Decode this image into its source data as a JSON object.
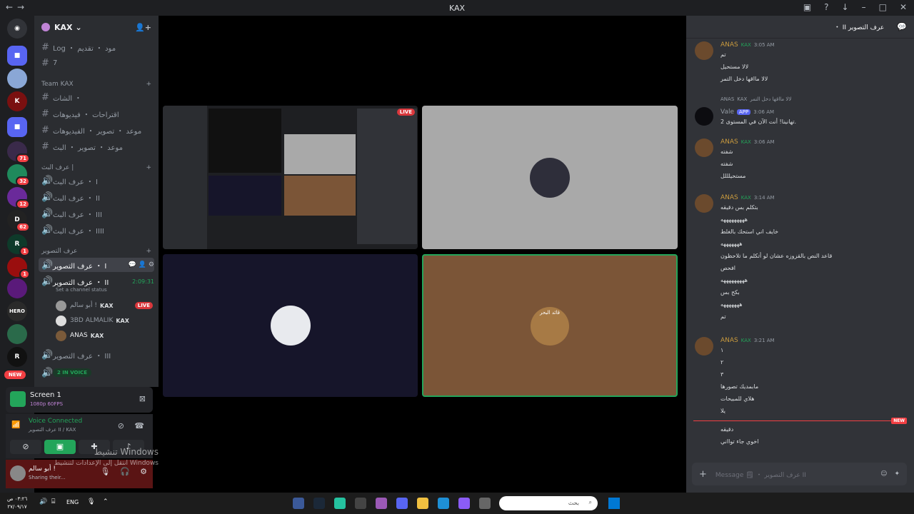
{
  "window": {
    "title": "KAX"
  },
  "servers": [
    {
      "icon": "discord-home-icon"
    },
    {
      "badge": ""
    },
    {
      "badge": ""
    },
    {
      "badge": ""
    },
    {
      "badge": "71"
    },
    {
      "badge": "32"
    },
    {
      "badge": "12"
    },
    {
      "badge": "62"
    },
    {
      "badge": "1"
    },
    {
      "badge": "1"
    },
    {
      "label": "HERO"
    },
    {
      "badge": ""
    },
    {
      "label": "R"
    },
    {
      "label": "NEW"
    }
  ],
  "server": {
    "name": "KAX"
  },
  "channels": {
    "top": [
      {
        "name": "Log ・ مود ・ تقديم"
      },
      {
        "name": "7"
      }
    ],
    "team_category": "Team KAX",
    "team": [
      {
        "name": "الشات ・"
      },
      {
        "name": "اقتراحات ・ فيديوهات"
      },
      {
        "name": "موعد ・ تصوير ・ الفيديوهات"
      },
      {
        "name": "موعد ・ تصوير ・ البث"
      }
    ],
    "broadcast_category": "عرف البث |",
    "broadcast": [
      {
        "name": "عرف البث ・ I"
      },
      {
        "name": "عرف البث ・ II"
      },
      {
        "name": "عرف البث ・ III"
      },
      {
        "name": "عرف البث ・ IIII"
      }
    ],
    "photo_category": "عرف التصوير",
    "photo1": "عرف التصوير ・ I",
    "photo2": "عرف التصوير ・ II",
    "photo2_time": "2:09:31",
    "status": "Set a channel status",
    "voice_users": [
      {
        "name": "أبو سالم !",
        "tag": "KAX",
        "live": "LIVE"
      },
      {
        "name": "3BD ALMALIK",
        "tag": "KAX"
      },
      {
        "name": "ANAS",
        "tag": "KAX"
      }
    ],
    "photo3": "عرف التصوير ・ III",
    "photo4_count": "2 IN VOICE"
  },
  "stream": {
    "title": "Screen 1",
    "quality": "1080p 60FPS"
  },
  "voice": {
    "status": "Voice Connected",
    "channel": "عرف التصوير II / KAX"
  },
  "user": {
    "name": "أبو سالم !",
    "status": "Sharing their..."
  },
  "watermark": {
    "line1": "تنشيط Windows",
    "line2": "انتقل إلى الإعدادات لتنشيط Windows"
  },
  "chat": {
    "channel": "عرف التصوير II ・",
    "messages": [
      {
        "author": "ANAS",
        "tag": "KAX",
        "time": "3:05 AM",
        "lines": [
          "تم",
          "لالا مستحيل",
          "لالا مااقها دخل التمر"
        ]
      },
      {
        "reply_author": "ANAS",
        "reply_tag": "KAX",
        "reply": "لالا مااقها دخل التمر",
        "author": "Vale",
        "tag": "APP",
        "time": "3:06 AM",
        "lines": [
          "تهانينا! أنت الآن في المستوى 2."
        ]
      },
      {
        "author": "ANAS",
        "tag": "KAX",
        "time": "3:06 AM",
        "lines": [
          "شفته",
          "شفته",
          "مستحيلللل"
        ]
      },
      {
        "author": "ANAS",
        "tag": "KAX",
        "time": "3:14 AM",
        "lines": [
          "بتكلم بس دقيقه",
          "هههههههههه",
          "خايف اني استحك بالغلط",
          "هههههههه",
          "قاعد النص بالقزوزه عشان لو أتكلم ما تلاحظون",
          "افحص",
          "هههههههههه",
          "بكح بس",
          "هههههههه",
          "تم"
        ]
      },
      {
        "author": "ANAS",
        "tag": "KAX",
        "time": "3:21 AM",
        "lines": [
          "١",
          "٢",
          "٣",
          "مابمديك تصورها",
          "هلاي للمبيحات",
          "يلا"
        ]
      }
    ],
    "new_label": "NEW",
    "after_new": [
      "دقيقه",
      "اخوي جاء توااني"
    ],
    "placeholder": "Message 🗒 ・ عرف التصوير II"
  },
  "tiles": {
    "thumb_live": "LIVE",
    "brown_caption": "قائد البحر"
  },
  "taskbar": {
    "time": "٠٣:٢٦ ص",
    "date": "٢٧/٠٩/١٧",
    "lang": "ENG",
    "search": "بحث"
  },
  "colors": {
    "accent": "#23a55a",
    "live": "#da373c",
    "brown": "#7b5537",
    "gold": "#c99a3e"
  }
}
